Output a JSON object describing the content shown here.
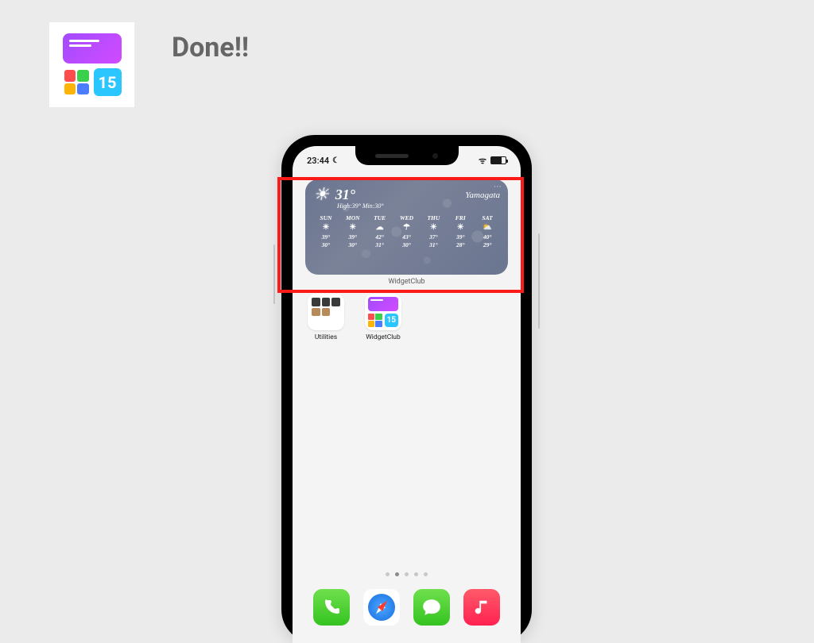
{
  "headline": "Done!!",
  "figure_icon": {
    "cal_number": "15"
  },
  "phone": {
    "status": {
      "time": "23:44",
      "moon": "☾"
    },
    "widget": {
      "label": "WidgetClub",
      "city": "Yamagata",
      "current_temp": "31°",
      "hilo": "High:39° Min:30°",
      "days": [
        {
          "name": "SUN",
          "icon": "☀",
          "hi": "39°",
          "lo": "30°"
        },
        {
          "name": "MON",
          "icon": "☀",
          "hi": "39°",
          "lo": "30°"
        },
        {
          "name": "TUE",
          "icon": "☁",
          "hi": "42°",
          "lo": "31°"
        },
        {
          "name": "WED",
          "icon": "☂",
          "hi": "43°",
          "lo": "30°"
        },
        {
          "name": "THU",
          "icon": "☀",
          "hi": "37°",
          "lo": "31°"
        },
        {
          "name": "FRI",
          "icon": "☀",
          "hi": "39°",
          "lo": "28°"
        },
        {
          "name": "SAT",
          "icon": "⛅",
          "hi": "40°",
          "lo": "29°"
        }
      ]
    },
    "apps": {
      "utilities_label": "Utilities",
      "widgetclub_label": "WidgetClub",
      "widgetclub_cal": "15"
    },
    "page_dots": {
      "count": 5,
      "active_index": 1
    },
    "dock": {
      "phone": "phone",
      "safari": "safari",
      "messages": "messages",
      "music": "music"
    },
    "colors": {
      "highlight": "#fc1b18",
      "widget_bg": "#6e7893"
    }
  }
}
